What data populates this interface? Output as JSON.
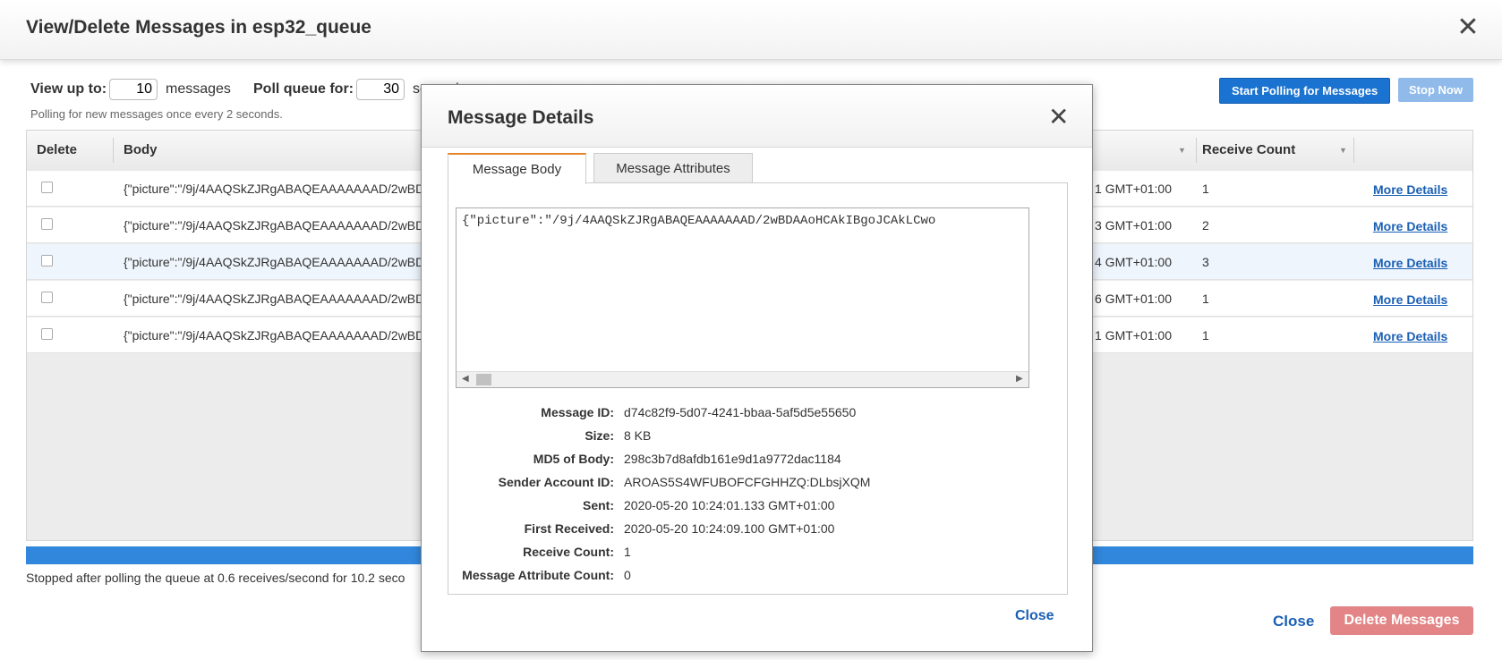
{
  "window": {
    "title": "View/Delete Messages in esp32_queue",
    "close_glyph": "✕"
  },
  "controls": {
    "view_up_to_label": "View up to:",
    "view_up_to_value": "10",
    "messages_label": "messages",
    "poll_label": "Poll queue for:",
    "poll_value": "30",
    "seconds_label": "seconds",
    "poll_note": "Polling for new messages once every 2 seconds.",
    "start_button": "Start Polling for Messages",
    "stop_button": "Stop Now"
  },
  "table": {
    "columns": [
      "Delete",
      "Body",
      "Receive Count"
    ],
    "rows": [
      {
        "body": "{\"picture\":\"/9j/4AAQSkZJRgABAQEAAAAAAAD/2wBDAAoHCAkIBgoJCAkLCwo",
        "sent": "2020-05-20 10:24:01.133 GMT+01:00",
        "sent_visible": "1 GMT+01:00",
        "receive_count": "1",
        "link": "More Details"
      },
      {
        "body": "{\"picture\":\"/9j/4AAQSkZJRgABAQEAAAAAAAD/2wBDAAoHCAkIBgoJCAkLCwo",
        "sent_visible": "3 GMT+01:00",
        "receive_count": "2",
        "link": "More Details"
      },
      {
        "body": "{\"picture\":\"/9j/4AAQSkZJRgABAQEAAAAAAAD/2wBDAAoHCAkIBgoJCAkLCwo",
        "sent_visible": "4 GMT+01:00",
        "receive_count": "3",
        "link": "More Details"
      },
      {
        "body": "{\"picture\":\"/9j/4AAQSkZJRgABAQEAAAAAAAD/2wBDAAoHCAkIBgoJCAkLCwo",
        "sent_visible": "6 GMT+01:00",
        "receive_count": "1",
        "link": "More Details"
      },
      {
        "body": "{\"picture\":\"/9j/4AAQSkZJRgABAQEAAAAAAAD/2wBDAAoHCAkIBgoJCAkLCwo",
        "sent_visible": "1 GMT+01:00",
        "receive_count": "1",
        "link": "More Details"
      }
    ]
  },
  "footer": {
    "status": "Stopped after polling the queue at 0.6 receives/second for 10.2 seco",
    "close": "Close",
    "delete_button": "Delete Messages",
    "progress": 1.0
  },
  "modal": {
    "title": "Message Details",
    "close_glyph": "✕",
    "tabs": [
      "Message Body",
      "Message Attributes"
    ],
    "active_tab": "Message Body",
    "body_text": "{\"picture\":\"/9j/4AAQSkZJRgABAQEAAAAAAAD/2wBDAAoHCAkIBgoJCAkLCwo",
    "details": [
      {
        "label": "Message ID:",
        "value": "d74c82f9-5d07-4241-bbaa-5af5d5e55650"
      },
      {
        "label": "Size:",
        "value": "8 KB"
      },
      {
        "label": "MD5 of Body:",
        "value": "298c3b7d8afdb161e9d1a9772dac1184"
      },
      {
        "label": "Sender Account ID:",
        "value": "AROAS5S4WFUBOFCFGHHZQ:DLbsjXQM"
      },
      {
        "label": "Sent:",
        "value": "2020-05-20 10:24:01.133 GMT+01:00"
      },
      {
        "label": "First Received:",
        "value": "2020-05-20 10:24:09.100 GMT+01:00"
      },
      {
        "label": "Receive Count:",
        "value": "1"
      },
      {
        "label": "Message Attribute Count:",
        "value": "0"
      }
    ],
    "close": "Close"
  }
}
